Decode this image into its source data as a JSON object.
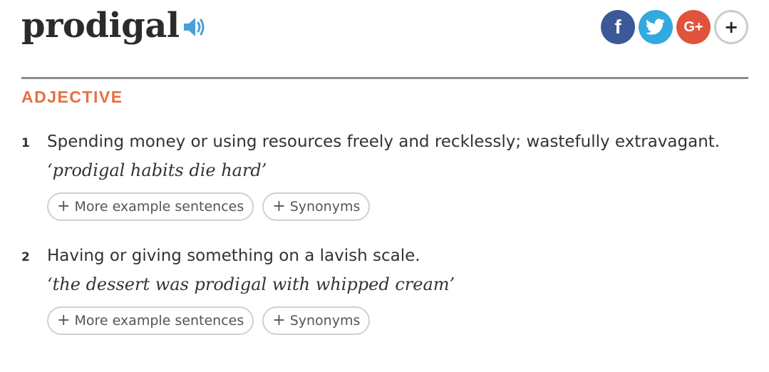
{
  "entry": {
    "headword": "prodigal",
    "audio_icon": "speaker-icon",
    "part_of_speech": "ADJECTIVE",
    "pos_color": "#e86f3f"
  },
  "social": {
    "facebook": {
      "icon": "facebook-icon",
      "color": "#3b5998",
      "glyph": "f"
    },
    "twitter": {
      "icon": "twitter-icon",
      "color": "#32a9e0"
    },
    "google": {
      "icon": "google-plus-icon",
      "color": "#e0533d",
      "glyph": "G+"
    },
    "more": {
      "icon": "plus-icon",
      "glyph": "+"
    }
  },
  "senses": [
    {
      "number": "1",
      "definition": "Spending money or using resources freely and recklessly; wastefully extravagant.",
      "example": "‘prodigal habits die hard’",
      "more_examples_label": "More example sentences",
      "synonyms_label": "Synonyms"
    },
    {
      "number": "2",
      "definition": "Having or giving something on a lavish scale.",
      "example": "‘the dessert was prodigal with whipped cream’",
      "more_examples_label": "More example sentences",
      "synonyms_label": "Synonyms"
    }
  ],
  "pill_glyph": "+"
}
